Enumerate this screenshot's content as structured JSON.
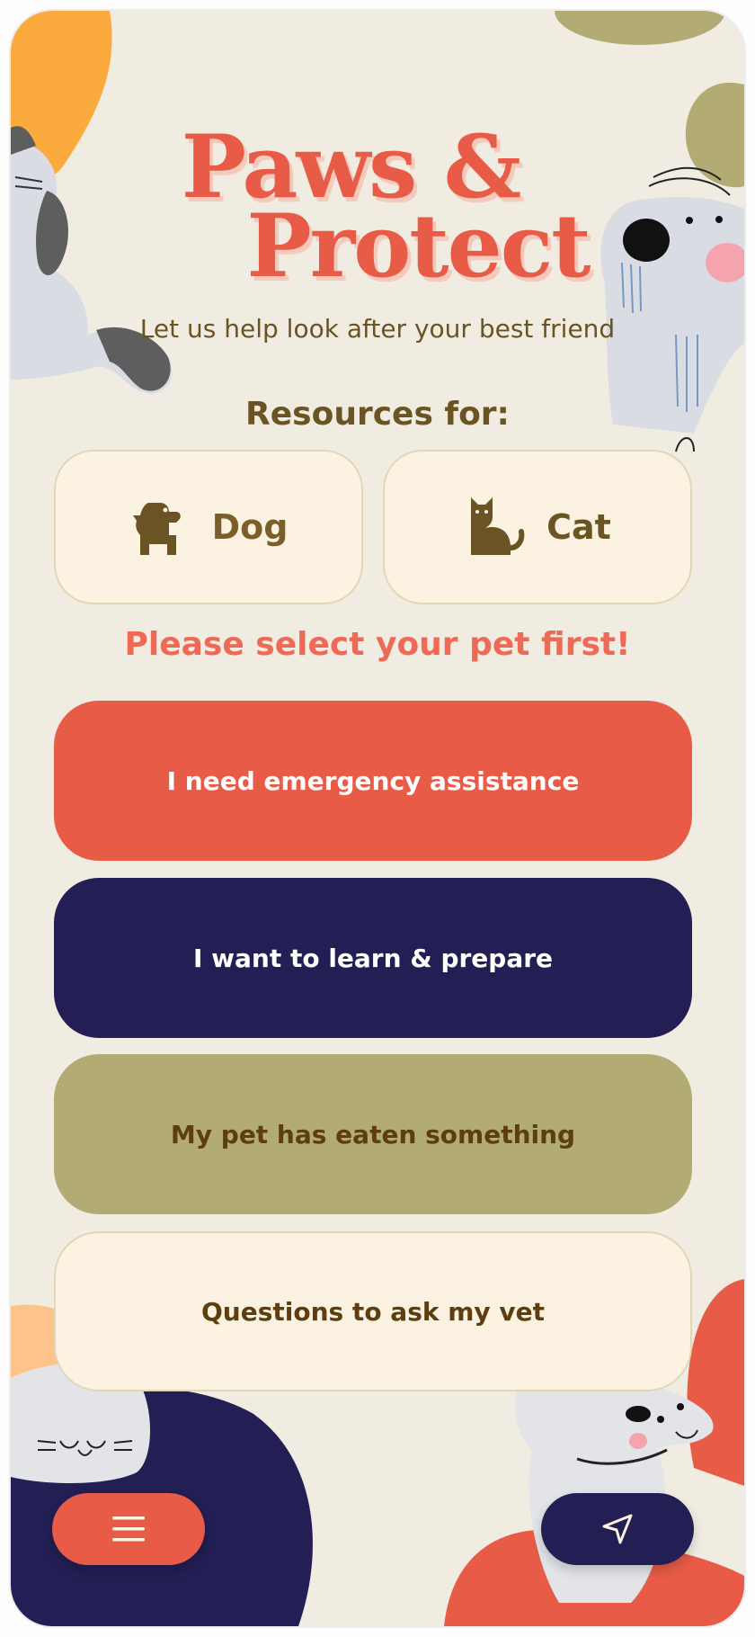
{
  "app": {
    "title_line1": "Paws &",
    "title_line2": "Protect",
    "subtitle": "Let us help look after your best friend"
  },
  "resources": {
    "heading": "Resources for:",
    "pets": [
      {
        "label": "Dog",
        "icon": "dog-icon"
      },
      {
        "label": "Cat",
        "icon": "cat-icon"
      }
    ],
    "warning": "Please select your pet first!"
  },
  "actions": [
    {
      "label": "I need emergency assistance"
    },
    {
      "label": "I want to learn & prepare"
    },
    {
      "label": "My pet has eaten something"
    },
    {
      "label": "Questions to ask my vet"
    }
  ],
  "footer": {
    "menu_icon": "menu-icon",
    "send_icon": "send-icon"
  },
  "colors": {
    "background": "#f1ece1",
    "coral": "#e85b47",
    "navy": "#231e54",
    "olive": "#b2ab74",
    "cream": "#fbf2e1",
    "brown": "#6b5424"
  }
}
